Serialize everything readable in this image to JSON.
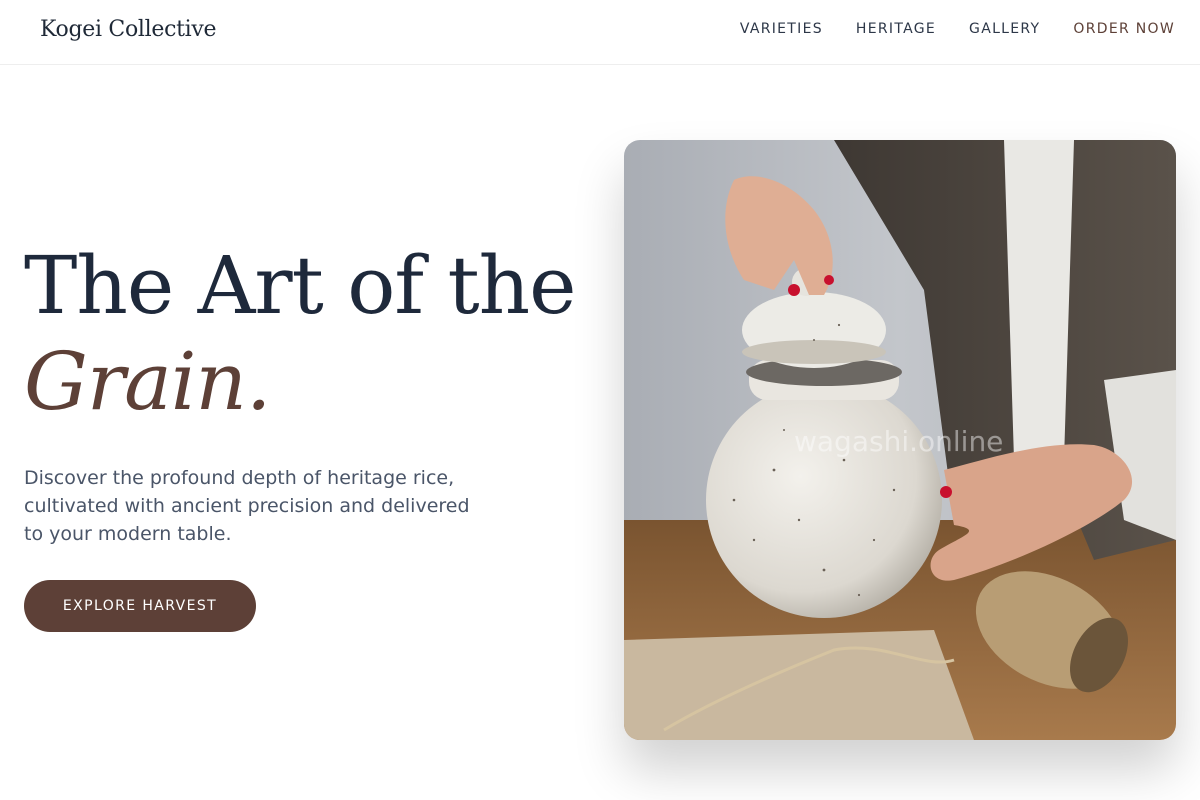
{
  "header": {
    "brand": "Kogei Collective",
    "nav": [
      {
        "label": "VARIETIES"
      },
      {
        "label": "HERITAGE"
      },
      {
        "label": "GALLERY"
      },
      {
        "label": "ORDER NOW"
      }
    ]
  },
  "hero": {
    "title_line1": "The Art of the",
    "title_line2": "Grain.",
    "description": "Discover the profound depth of heritage rice, cultivated with ancient precision and delivered to your modern table.",
    "cta_label": "EXPLORE HARVEST",
    "image_watermark": "wagashi.online"
  },
  "colors": {
    "accent": "#5d4037",
    "heading": "#1e293b",
    "body": "#4a5568"
  }
}
